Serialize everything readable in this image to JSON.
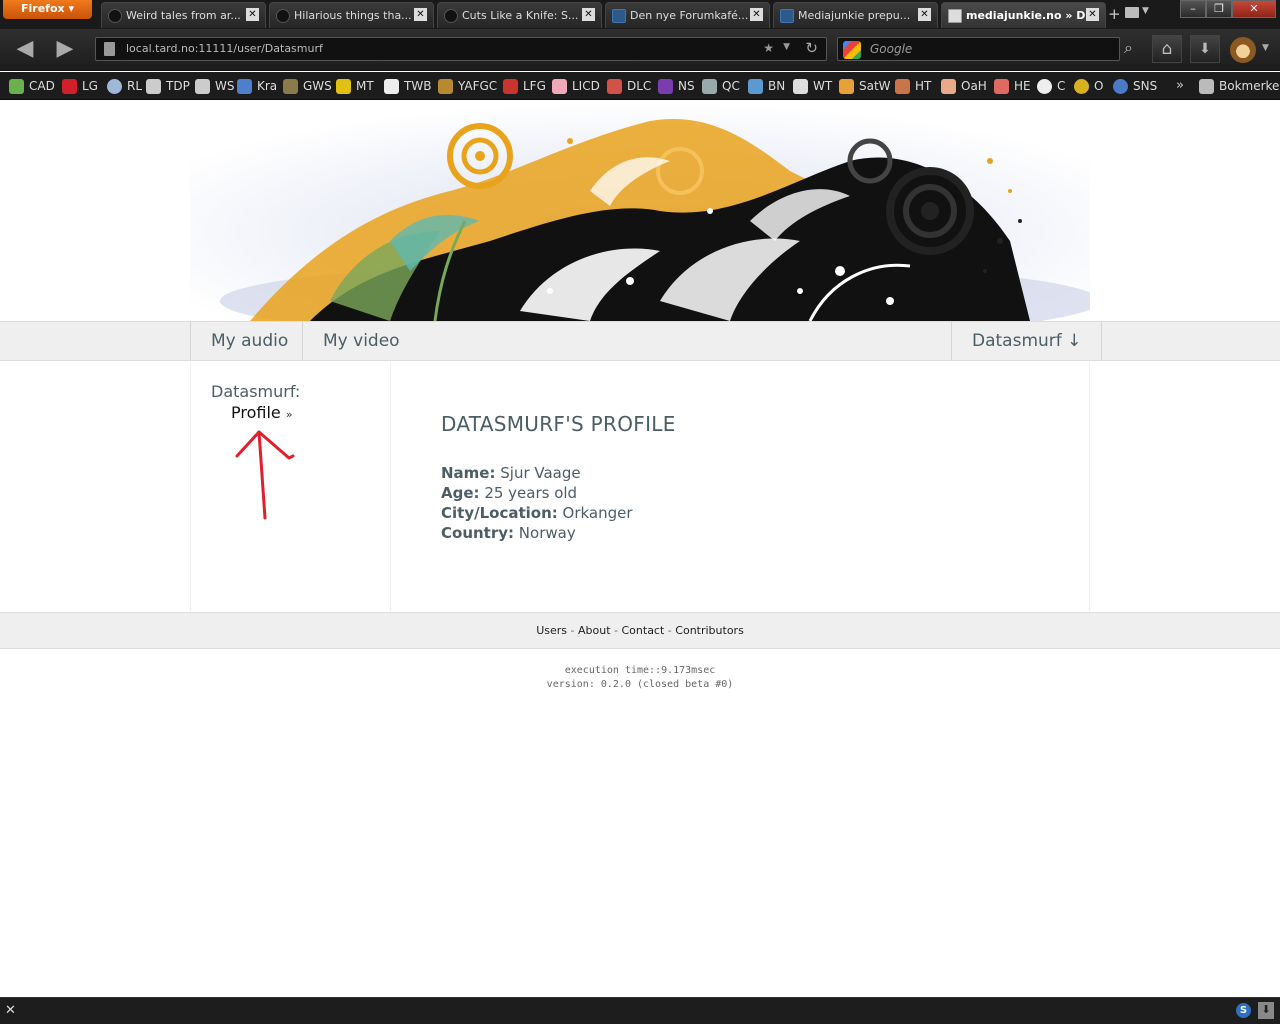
{
  "browser": {
    "menu_button": "Firefox",
    "tabs": [
      {
        "title": "Weird tales from ar..."
      },
      {
        "title": "Hilarious things tha..."
      },
      {
        "title": "Cuts Like a Knife: S..."
      },
      {
        "title": "Den nye Forumkafé..."
      },
      {
        "title": "Mediajunkie prepu..."
      },
      {
        "title": "mediajunkie.no » D..."
      }
    ],
    "url": "local.tard.no:11111/user/Datasmurf",
    "search_placeholder": "Google",
    "bookmarks": [
      "CAD",
      "LG",
      "RL",
      "TDP",
      "WS",
      "Kra",
      "GWS",
      "MT",
      "TWB",
      "YAFGC",
      "LFG",
      "LICD",
      "DLC",
      "NS",
      "QC",
      "BN",
      "WT",
      "SatW",
      "HT",
      "OaH",
      "HE",
      "C",
      "O",
      "SNS"
    ],
    "bookmarks_menu": "Bokmerker"
  },
  "site": {
    "menu": {
      "audio": "My audio",
      "video": "My video",
      "user": "Datasmurf ↓"
    },
    "sidebar": {
      "user_label": "Datasmurf:",
      "profile_link": "Profile",
      "profile_suffix": "»"
    },
    "profile": {
      "heading": "DATASMURF'S PROFILE",
      "name_label": "Name:",
      "name_value": "Sjur Vaage",
      "age_label": "Age:",
      "age_value": "25 years old",
      "city_label": "City/Location:",
      "city_value": "Orkanger",
      "country_label": "Country:",
      "country_value": "Norway"
    },
    "footer": {
      "links": [
        "Users",
        "About",
        "Contact",
        "Contributors"
      ],
      "separator": "-"
    },
    "meta": {
      "execution_time": "execution time::9.173msec",
      "version": "version: 0.2.0 (closed beta #0)"
    }
  },
  "colors": {
    "accent_text": "#4b5d66",
    "annotation_arrow": "#e0202a"
  }
}
